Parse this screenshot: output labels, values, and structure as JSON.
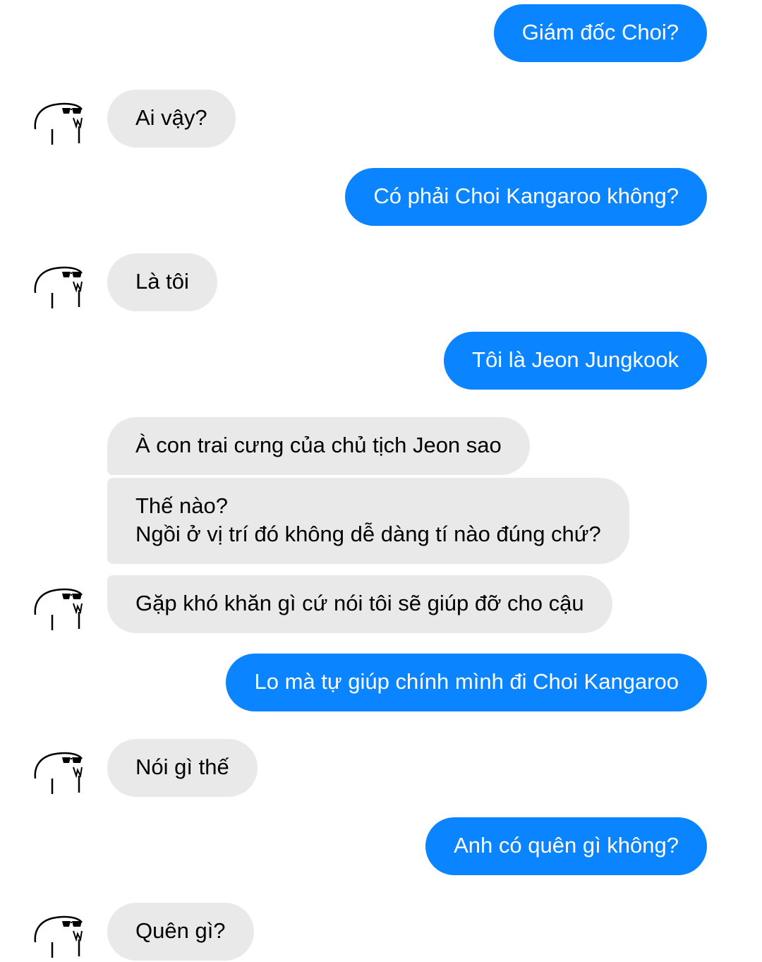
{
  "conversation": {
    "messages": [
      {
        "side": "outgoing",
        "text": "Giám đốc Choi?"
      },
      {
        "side": "incoming",
        "text": "Ai vậy?"
      },
      {
        "side": "outgoing",
        "text": "Có phải Choi Kangaroo không?"
      },
      {
        "side": "incoming",
        "text": "Là tôi"
      },
      {
        "side": "outgoing",
        "text": "Tôi là Jeon Jungkook"
      },
      {
        "side": "incoming",
        "text": "À con trai cưng của chủ tịch Jeon sao"
      },
      {
        "side": "incoming",
        "text": "Thế nào?\nNgồi ở vị trí đó không dễ dàng tí nào đúng chứ?"
      },
      {
        "side": "incoming",
        "text": "Gặp khó khăn gì cứ nói tôi sẽ giúp đỡ cho cậu"
      },
      {
        "side": "outgoing",
        "text": "Lo mà tự giúp chính mình đi Choi Kangaroo"
      },
      {
        "side": "incoming",
        "text": "Nói gì thế"
      },
      {
        "side": "outgoing",
        "text": "Anh có quên gì không?"
      },
      {
        "side": "incoming",
        "text": "Quên gì?"
      }
    ]
  },
  "colors": {
    "outgoing_bubble": "#0a84ff",
    "incoming_bubble": "#e9e9e9",
    "background": "#ffffff"
  },
  "avatar": {
    "icon": "sunglasses-meme-avatar-icon"
  }
}
